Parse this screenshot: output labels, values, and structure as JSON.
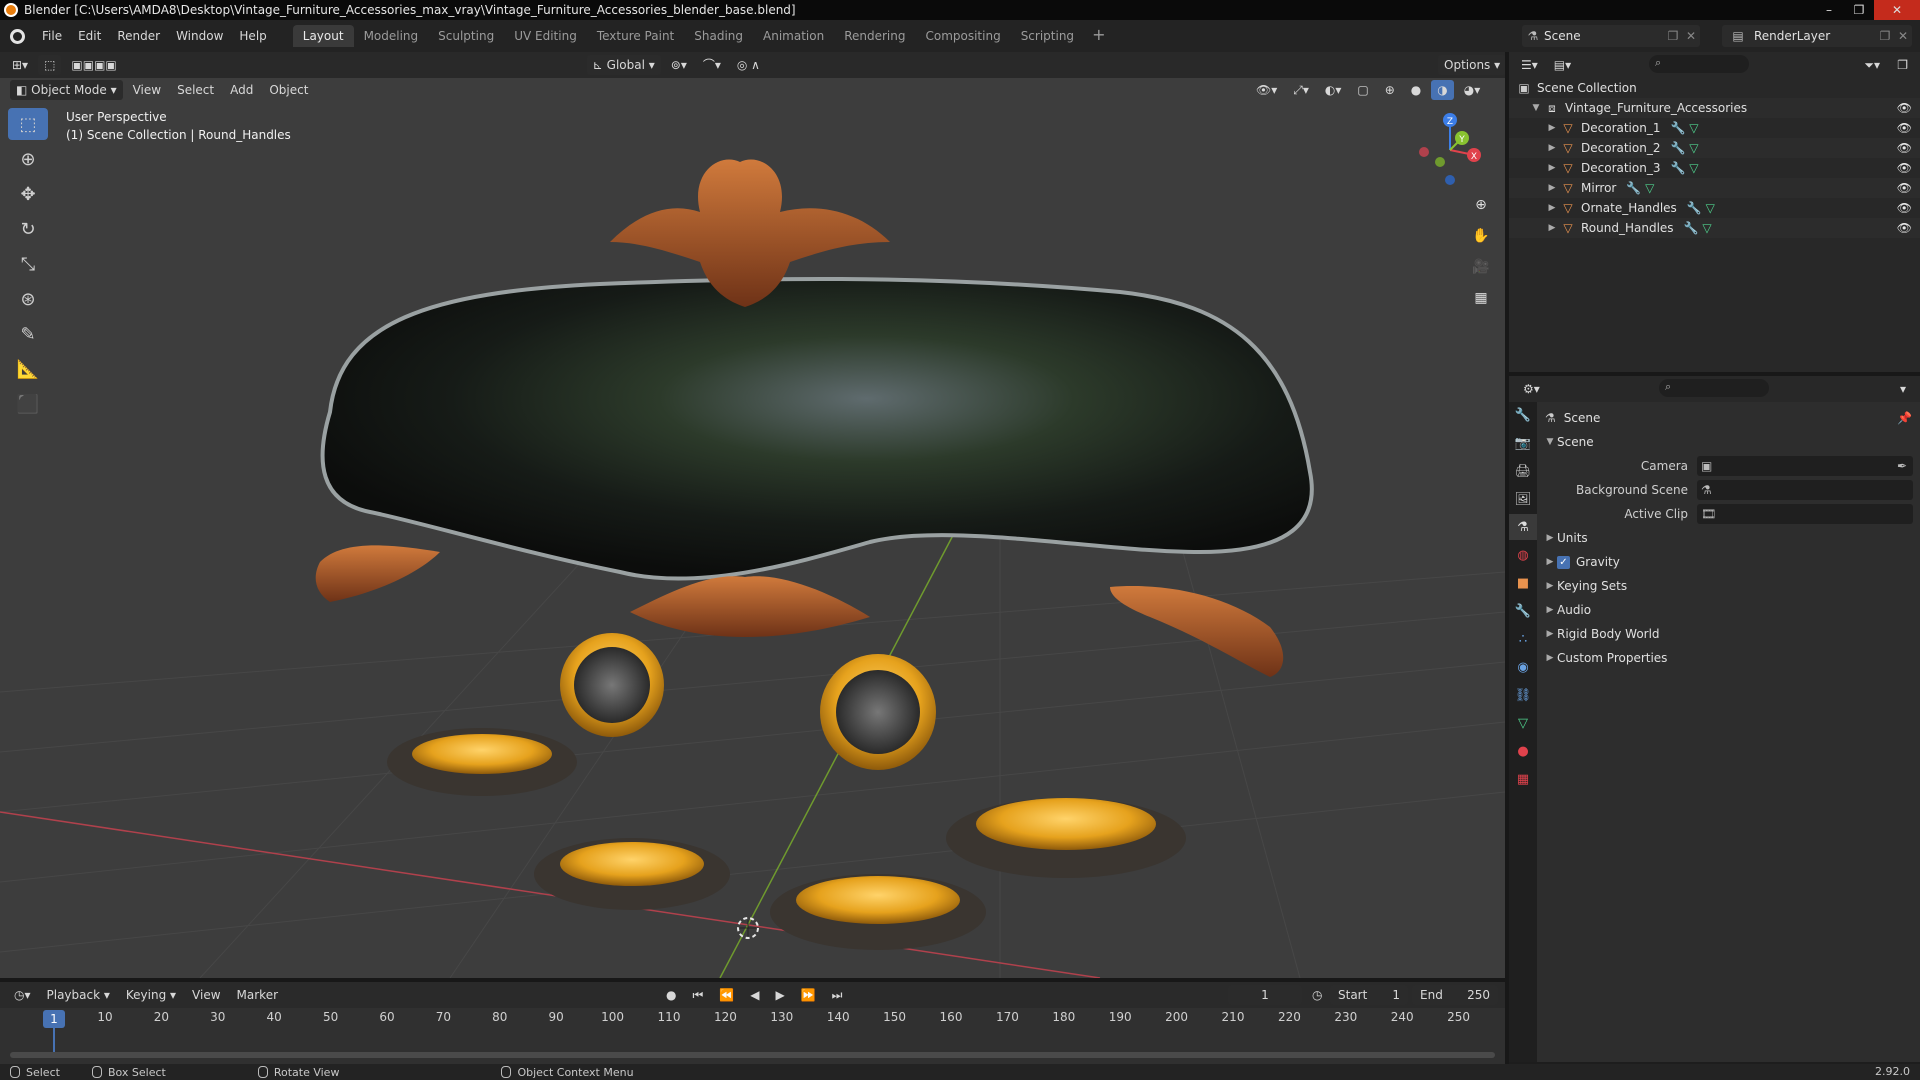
{
  "window": {
    "title": "Blender [C:\\Users\\AMDA8\\Desktop\\Vintage_Furniture_Accessories_max_vray\\Vintage_Furniture_Accessories_blender_base.blend]",
    "controls": [
      "–",
      "❐",
      "✕"
    ]
  },
  "menu": {
    "items": [
      "File",
      "Edit",
      "Render",
      "Window",
      "Help"
    ]
  },
  "workspaces": {
    "tabs": [
      "Layout",
      "Modeling",
      "Sculpting",
      "UV Editing",
      "Texture Paint",
      "Shading",
      "Animation",
      "Rendering",
      "Compositing",
      "Scripting"
    ],
    "active": "Layout",
    "add": "+"
  },
  "scene_selector": {
    "label": "Scene",
    "icon": "scene-icon"
  },
  "renderlayer_selector": {
    "label": "RenderLayer",
    "icon": "renderlayer-icon"
  },
  "viewport": {
    "mode": "Object Mode",
    "menus": [
      "View",
      "Select",
      "Add",
      "Object"
    ],
    "orientation": "Global",
    "options": "Options",
    "info_line1": "User Perspective",
    "info_line2": "(1) Scene Collection | Round_Handles",
    "gizmo_axes": {
      "z": "Z",
      "y": "Y",
      "x": "X"
    },
    "colors": {
      "x": "#e0424c",
      "y": "#89c330",
      "z": "#3c7ee8",
      "active_tool": "#4772b3"
    },
    "tools": [
      "select-box-icon",
      "cursor-icon",
      "move-icon",
      "rotate-icon",
      "scale-icon",
      "transform-icon",
      "annotate-icon",
      "measure-icon",
      "add-cube-icon"
    ]
  },
  "timeline": {
    "menus": [
      "Playback",
      "Keying",
      "View",
      "Marker"
    ],
    "current_frame": "1",
    "start_label": "Start",
    "start": "1",
    "end_label": "End",
    "end": "250",
    "ruler": [
      "10",
      "20",
      "30",
      "40",
      "50",
      "60",
      "70",
      "80",
      "90",
      "100",
      "110",
      "120",
      "130",
      "140",
      "150",
      "160",
      "170",
      "180",
      "190",
      "200",
      "210",
      "220",
      "230",
      "240",
      "250"
    ],
    "cursor_label": "1"
  },
  "statusbar": {
    "items": [
      "Select",
      "Box Select",
      "Rotate View",
      "Object Context Menu"
    ],
    "version": "2.92.0"
  },
  "outliner": {
    "root": "Scene Collection",
    "collection": "Vintage_Furniture_Accessories",
    "objects": [
      "Decoration_1",
      "Decoration_2",
      "Decoration_3",
      "Mirror",
      "Ornate_Handles",
      "Round_Handles"
    ]
  },
  "properties": {
    "context": "Scene",
    "panel_title": "Scene",
    "fields": {
      "camera_label": "Camera",
      "background_scene_label": "Background Scene",
      "active_clip_label": "Active Clip"
    },
    "panels": [
      "Units",
      "Gravity",
      "Keying Sets",
      "Audio",
      "Rigid Body World",
      "Custom Properties"
    ],
    "gravity_checked": true
  }
}
